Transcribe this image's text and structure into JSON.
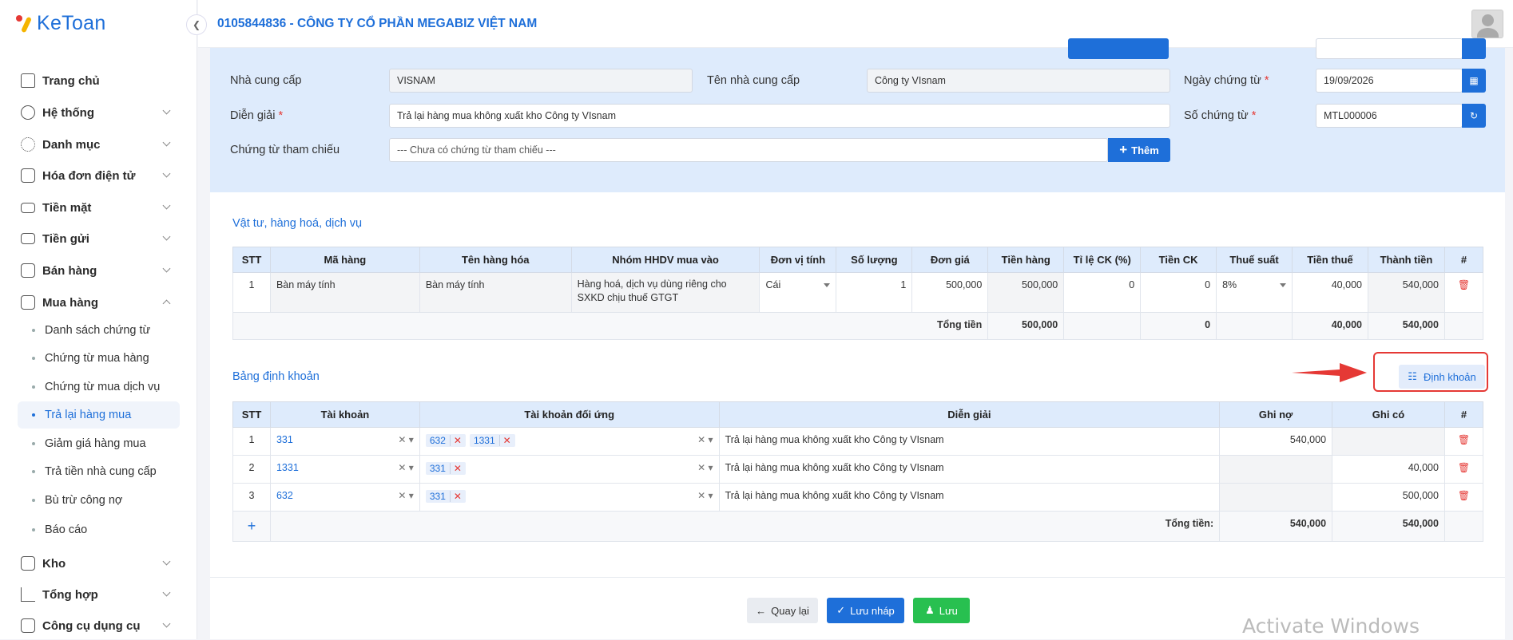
{
  "brand": {
    "name": "KeToan"
  },
  "header": {
    "company": "0105844836 - CÔNG TY CỔ PHẦN MEGABIZ VIỆT NAM"
  },
  "sidebar": {
    "items": [
      {
        "label": "Trang chủ",
        "icon": "home-icon",
        "expandable": false
      },
      {
        "label": "Hệ thống",
        "icon": "gear-icon",
        "expandable": true
      },
      {
        "label": "Danh mục",
        "icon": "grid-icon",
        "expandable": true
      },
      {
        "label": "Hóa đơn điện tử",
        "icon": "building-icon",
        "expandable": true
      },
      {
        "label": "Tiền mặt",
        "icon": "cash-icon",
        "expandable": true
      },
      {
        "label": "Tiền gửi",
        "icon": "bank-icon",
        "expandable": true
      },
      {
        "label": "Bán hàng",
        "icon": "bag-icon",
        "expandable": true
      },
      {
        "label": "Mua hàng",
        "icon": "cart-icon",
        "expandable": true,
        "open": true
      }
    ],
    "sub_items": [
      {
        "label": "Danh sách chứng từ"
      },
      {
        "label": "Chứng từ mua hàng"
      },
      {
        "label": "Chứng từ mua dịch vụ"
      },
      {
        "label": "Trả lại hàng mua",
        "active": true
      },
      {
        "label": "Giảm giá hàng mua"
      },
      {
        "label": "Trả tiền nhà cung cấp"
      },
      {
        "label": "Bù trừ công nợ"
      },
      {
        "label": "Báo cáo"
      }
    ],
    "bottom_items": [
      {
        "label": "Kho",
        "icon": "box-icon"
      },
      {
        "label": "Tổng hợp",
        "icon": "chart-icon"
      },
      {
        "label": "Công cụ dụng cụ",
        "icon": "tool-icon"
      }
    ]
  },
  "form": {
    "supplier_label": "Nhà cung cấp",
    "supplier_value": "VISNAM",
    "supplier_name_label": "Tên nhà cung cấp",
    "supplier_name_value": "Công ty VIsnam",
    "doc_date_label": "Ngày chứng từ",
    "doc_date_value": "19/09/2026",
    "desc_label": "Diễn giải",
    "desc_value": "Trả lại hàng mua không xuất kho Công ty VIsnam",
    "doc_no_label": "Số chứng từ",
    "doc_no_value": "MTL000006",
    "ref_label": "Chứng từ tham chiếu",
    "ref_placeholder": "--- Chưa có chứng từ tham chiếu ---",
    "add_label": "Thêm",
    "required_mark": "*"
  },
  "goods": {
    "title": "Vật tư, hàng hoá, dịch vụ",
    "headers": [
      "STT",
      "Mã hàng",
      "Tên hàng hóa",
      "Nhóm HHDV mua vào",
      "Đơn vị tính",
      "Số lượng",
      "Đơn giá",
      "Tiền hàng",
      "Tỉ lệ CK (%)",
      "Tiền CK",
      "Thuế suất",
      "Tiền thuế",
      "Thành tiền",
      "#"
    ],
    "rows": [
      {
        "stt": "1",
        "code": "Bàn máy tính",
        "name": "Bàn máy tính",
        "group": "Hàng hoá, dịch vụ dùng riêng cho SXKD chịu thuế GTGT",
        "unit": "Cái",
        "qty": "1",
        "price": "500,000",
        "amount": "500,000",
        "disc_rate": "0",
        "disc_amount": "0",
        "tax_rate": "8%",
        "tax": "40,000",
        "total": "540,000"
      }
    ],
    "totals": {
      "label": "Tổng tiền",
      "amount": "500,000",
      "disc": "0",
      "tax": "40,000",
      "total": "540,000"
    }
  },
  "accounting": {
    "title": "Bảng định khoản",
    "button_label": "Định khoản",
    "headers": [
      "STT",
      "Tài khoản",
      "Tài khoản đối ứng",
      "Diễn giải",
      "Ghi nợ",
      "Ghi có",
      "#"
    ],
    "rows": [
      {
        "stt": "1",
        "account": "331",
        "counter": [
          "632",
          "1331"
        ],
        "desc": "Trả lại hàng mua không xuất kho Công ty VIsnam",
        "debit": "540,000",
        "credit": ""
      },
      {
        "stt": "2",
        "account": "1331",
        "counter": [
          "331"
        ],
        "desc": "Trả lại hàng mua không xuất kho Công ty VIsnam",
        "debit": "",
        "credit": "40,000"
      },
      {
        "stt": "3",
        "account": "632",
        "counter": [
          "331"
        ],
        "desc": "Trả lại hàng mua không xuất kho Công ty VIsnam",
        "debit": "",
        "credit": "500,000"
      }
    ],
    "add_row": "+",
    "totals": {
      "label": "Tổng tiền:",
      "debit": "540,000",
      "credit": "540,000"
    }
  },
  "footer": {
    "back_label": "Quay lại",
    "draft_label": "Lưu nháp",
    "save_label": "Lưu"
  },
  "watermark": "Activate Windows",
  "colors": {
    "accent": "#1e6fd9",
    "danger": "#e53935",
    "success": "#28c050"
  }
}
